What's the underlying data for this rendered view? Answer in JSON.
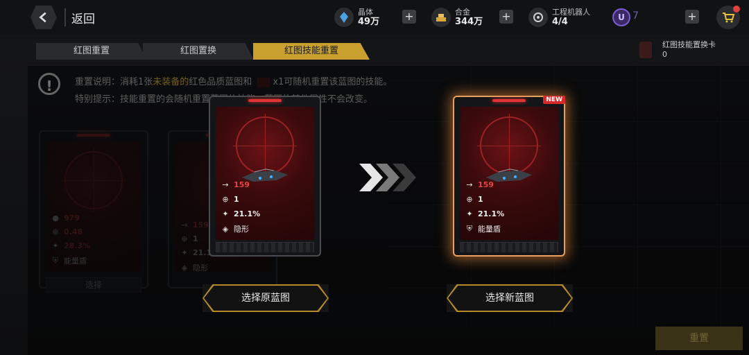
{
  "header": {
    "back_label": "返回",
    "resources": [
      {
        "name": "晶体",
        "value": "49万",
        "icon": "crystal-icon"
      },
      {
        "name": "合金",
        "value": "344万",
        "icon": "alloy-icon"
      },
      {
        "name": "工程机器人",
        "value": "4/4",
        "icon": "robot-icon"
      }
    ],
    "u_currency": {
      "badge": "U",
      "value": "7"
    }
  },
  "tabs": [
    {
      "label": "红图重置",
      "active": false
    },
    {
      "label": "红图置换",
      "active": false
    },
    {
      "label": "红图技能重置",
      "active": true
    }
  ],
  "top_right_item": {
    "name": "红图技能置换卡",
    "count": "0"
  },
  "info": {
    "line1_prefix": "重置说明：消耗1张",
    "line1_highlight": "未装备的",
    "line1_mid": "红色品质蓝图和",
    "line1_suffix": "x1可随机重置该蓝图的技能。",
    "line2": "特别提示：技能重置的会随机重置蓝图的技能，蓝图的其他属性不会改变。"
  },
  "left_cards": [
    {
      "stats": [
        "979",
        "0.48",
        "28.3%"
      ],
      "skill": "能量盾",
      "select_label": "选择"
    },
    {
      "stats": [
        "159",
        "1",
        "21.1%"
      ],
      "skill": "隐形"
    }
  ],
  "original_card": {
    "speed": "159",
    "count": "1",
    "rate": "21.1%",
    "skill": "隐形"
  },
  "new_card": {
    "badge": "NEW",
    "speed": "159",
    "count": "1",
    "rate": "21.1%",
    "skill": "能量盾"
  },
  "buttons": {
    "select_original": "选择原蓝图",
    "select_new": "选择新蓝图",
    "reset": "重置"
  },
  "colors": {
    "accent": "#c9a02e",
    "stat_red": "#e24646",
    "glow": "#e8a060"
  }
}
